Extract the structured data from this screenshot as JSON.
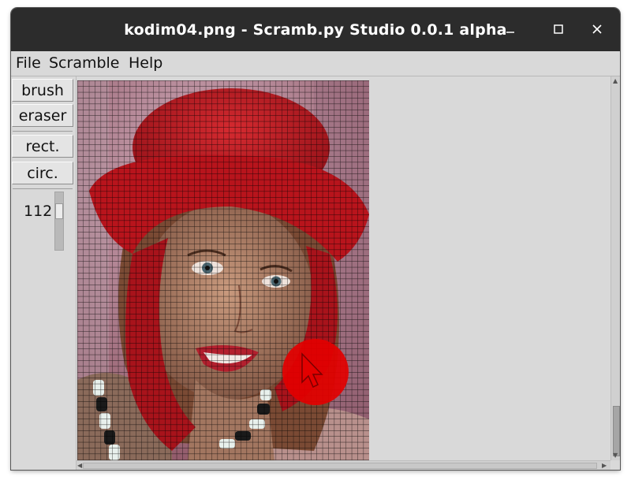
{
  "window": {
    "title": "kodim04.png - Scramb.py Studio 0.0.1 alpha",
    "controls": {
      "minimize_icon": "minimize-icon",
      "maximize_icon": "maximize-icon",
      "close_icon": "close-icon"
    }
  },
  "menubar": {
    "items": [
      "File",
      "Scramble",
      "Help"
    ]
  },
  "tools": {
    "brush_label": "brush",
    "eraser_label": "eraser",
    "rect_label": "rect.",
    "circ_label": "circ.",
    "brush_size": "112",
    "brush_size_fraction": 0.22
  },
  "canvas": {
    "image": "kodim04.png",
    "grid": true,
    "cursor_icon": "pointer-cursor-icon"
  },
  "colors": {
    "titlebar": "#2c2c2c",
    "chrome": "#d9d9d9",
    "brush_preview": "#e00000",
    "hat_red": "#c41b24"
  }
}
